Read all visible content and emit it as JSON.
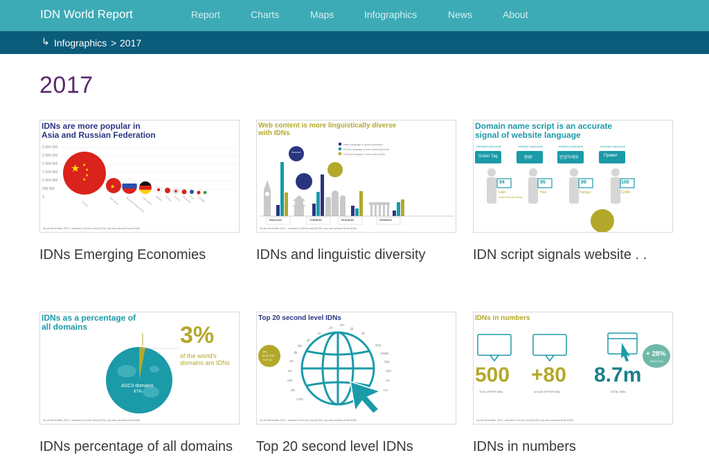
{
  "header": {
    "brand": "IDN World Report",
    "nav": [
      "Report",
      "Charts",
      "Maps",
      "Infographics",
      "News",
      "About"
    ]
  },
  "breadcrumb": {
    "parent": "Infographics",
    "separator": ">",
    "current": "2017"
  },
  "page": {
    "title": "2017"
  },
  "cards": [
    {
      "title": "IDNs Emerging Economies",
      "thumb": {
        "heading_line1": "IDNs are more popular in",
        "heading_line2": "Asia and Russian Federation",
        "y_ticks": [
          "3 000 000",
          "2 500 000",
          "2 000 000",
          "1 500 000",
          "1 000 000",
          "500 000",
          "0"
        ],
        "footnote": "As at December 2017, includes ccTLDs and gTLDs, top and second level IDNs"
      }
    },
    {
      "title": "IDNs and linguistic diversity",
      "thumb": {
        "heading_line1": "Web content is more linguistically diverse",
        "heading_line2": "with IDNs",
        "legend": [
          "Native language of global population",
          "Primary language of web content (general)",
          "Primary language of web content (IDN)"
        ],
        "languages": [
          "ENGLISH",
          "CHINESE",
          "RUSSIAN",
          "GERMAN"
        ],
        "language_sub": "LANGUAGE",
        "footnote": "As at December 2017, includes ccTLDs and gTLDs, top and second level IDNs"
      }
    },
    {
      "title": "IDN script signals website . .",
      "thumb": {
        "heading_line1": "Domain name script is an accurate",
        "heading_line2": "signal of website language",
        "groups": [
          {
            "label": "GERMAN LANGUAGE",
            "greeting": "Guten Tag",
            "percent": "94",
            "script": "Latin"
          },
          {
            "label": "CHINESE LANGUAGE",
            "greeting": "你好",
            "percent": "95",
            "script": "Han"
          },
          {
            "label": "KOREAN LANGUAGE",
            "greeting": "안녕하세요",
            "percent": "99",
            "script": "Hangul"
          },
          {
            "label": "RUSSIAN LANGUAGE",
            "greeting": "Привет",
            "percent": "100",
            "script": "Cyrillic"
          }
        ],
        "script_suffix": "script domain name",
        "percent_suffix": "%"
      }
    },
    {
      "title": "IDNs percentage of all domains",
      "thumb": {
        "heading_line1": "IDNs as a percentage of",
        "heading_line2": "all domains",
        "big_number": "3%",
        "caption_line1": "of the world's",
        "caption_line2": "domains are IDNs",
        "ascii_label": "ASCII domains",
        "ascii_percent": "97%",
        "footnote": "As at December 2017, includes ccTLDs and gTLDs, top and second level IDNs"
      }
    },
    {
      "title": "Top 20 second level IDNs",
      "thumb": {
        "heading": "Top 20 second level IDNs",
        "badge_line1": ".eu",
        "badge_line2": "IS IN THE",
        "badge_line3": "TOP 20",
        "tlds": [
          ".kr",
          ".ch",
          ".pl",
          ".jp",
          ".at",
          ".no",
          ".biz",
          ".org",
          ".dk",
          ".mobi",
          ".se",
          ".fop",
          ".eu",
          ".xyz",
          ".net",
          ".vn",
          ".de",
          ".cn",
          ".com"
        ],
        "footnote": "As at December 2017, includes ccTLDs and gTLDs, top and second level IDNs"
      }
    },
    {
      "title": "IDNs in numbers",
      "thumb": {
        "heading": "IDNs in numbers",
        "stats": [
          {
            "value": "500",
            "label": "TLDs OFFER IDNs"
          },
          {
            "value": "+80",
            "label": "ccTLDs OFFER IDNs"
          },
          {
            "value": "8.7m",
            "label": "TOTAL IDNs"
          }
        ],
        "growth": "+ 28%",
        "growth_label": "SINCE 2014",
        "footnote": "As at December 2017, includes ccTLDs and gTLDs, top and second level IDNs"
      }
    }
  ],
  "colors": {
    "nav_bg": "#3cabb5",
    "breadcrumb_bg": "#0a5c7a",
    "title_purple": "#5a2a6e",
    "teal": "#1b9aa8",
    "olive": "#b4a82c",
    "navy": "#2a3580",
    "red": "#d9231c"
  }
}
